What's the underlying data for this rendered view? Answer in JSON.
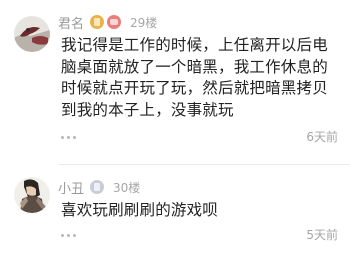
{
  "comments": [
    {
      "username": "君名",
      "floor": "29楼",
      "text": "我记得是工作的时候，上任离开以后电脑桌面就放了一个暗黑，我工作休息的时候就点开玩了玩，然后就把暗黑拷贝到我的本子上，没事就玩",
      "time": "6天前",
      "badges": [
        "level-badge-gold",
        "vip-badge-red"
      ]
    },
    {
      "username": "小丑",
      "floor": "30楼",
      "text": "喜欢玩刷刷刷的游戏呗",
      "time": "5天前",
      "badges": [
        "level-badge-gray"
      ]
    }
  ],
  "colors": {
    "name": "#9a9a9a",
    "text": "#222222",
    "meta": "#a6a6a6",
    "divider": "#ececec"
  }
}
